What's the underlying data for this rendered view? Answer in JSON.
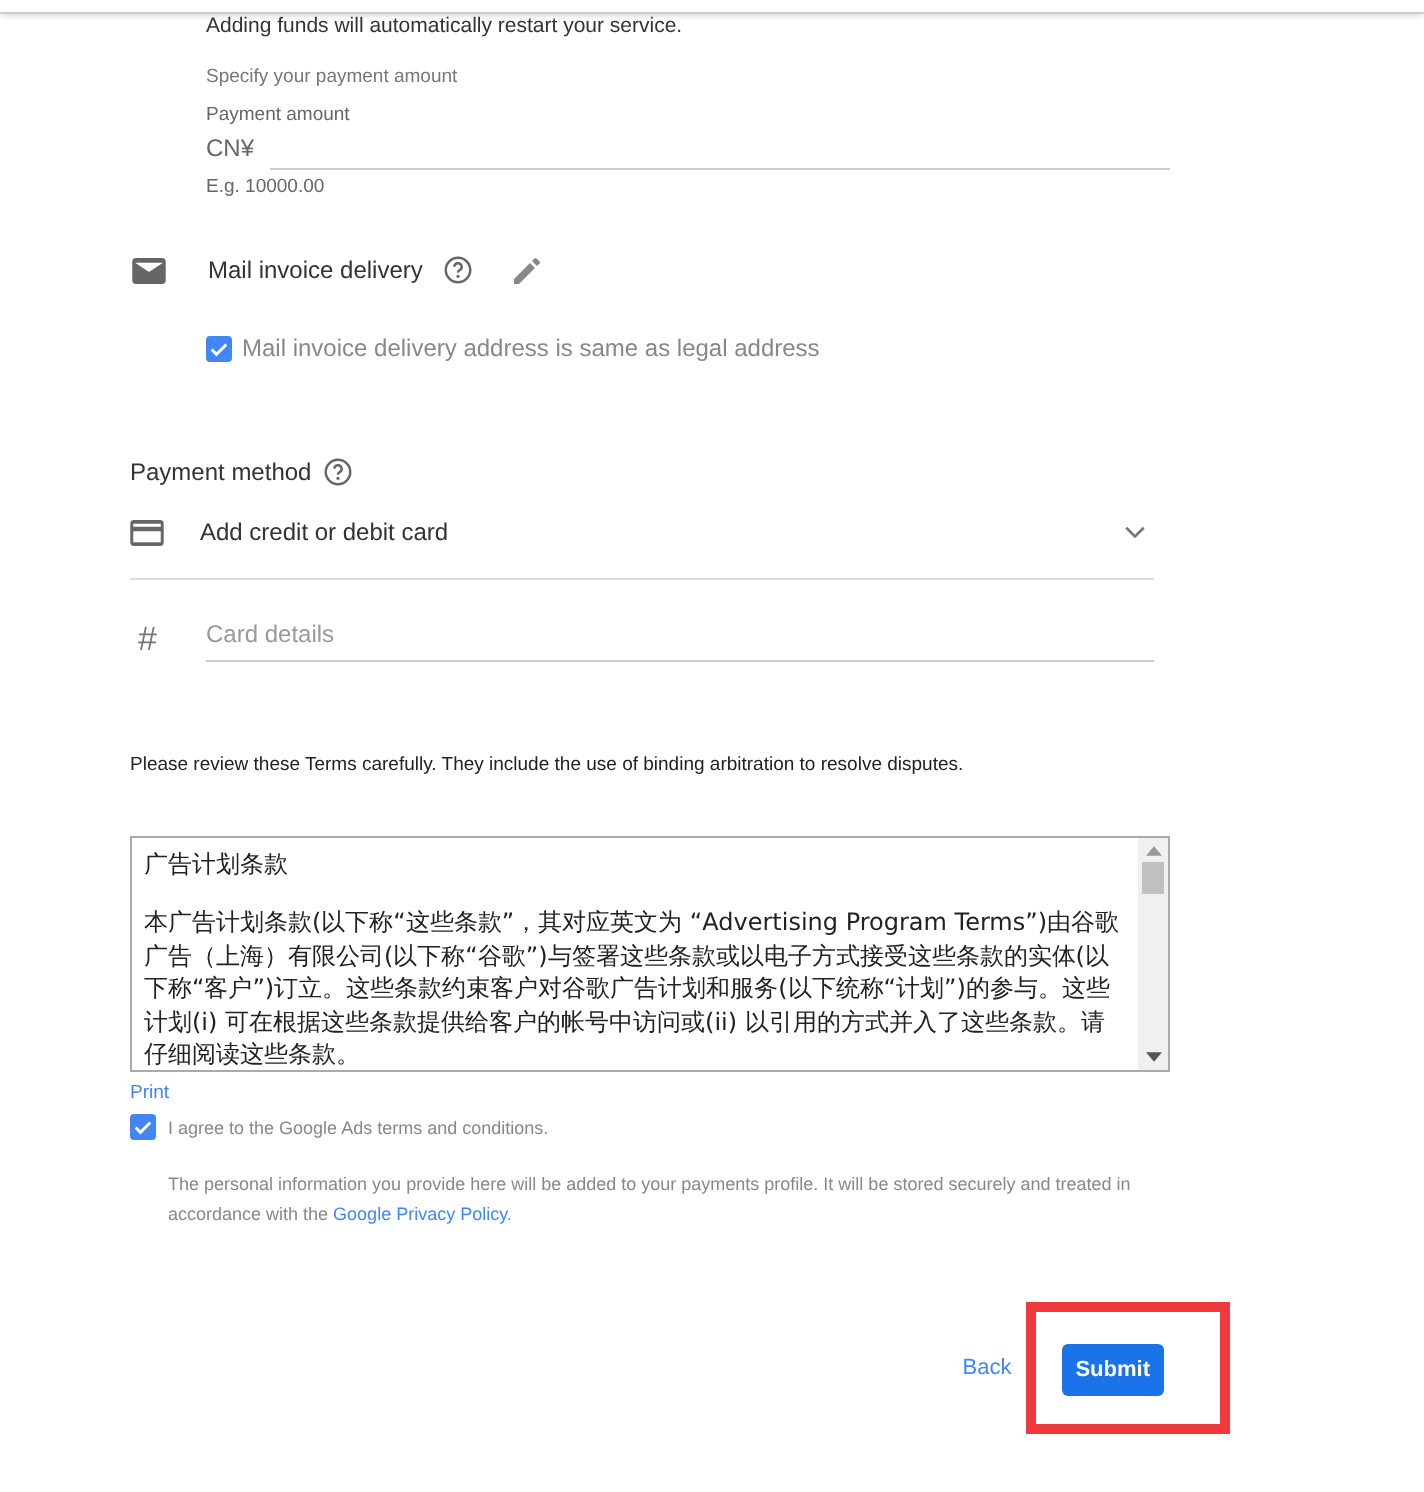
{
  "notice": "Adding funds will automatically restart your service.",
  "amount": {
    "hint": "Specify your payment amount",
    "label": "Payment amount",
    "currency": "CN¥",
    "helper": "E.g. 10000.00"
  },
  "mail_invoice": {
    "label": "Mail invoice delivery",
    "same_address": {
      "label": "Mail invoice delivery address is same as legal address",
      "checked": true
    }
  },
  "payment_method": {
    "title": "Payment method",
    "option": "Add credit or debit card",
    "card_field": {
      "icon": "#",
      "placeholder": "Card details"
    }
  },
  "terms_notice": "Please review these Terms carefully. They include the use of binding arbitration to resolve disputes.",
  "terms": {
    "title": "广告计划条款",
    "body": "本广告计划条款(以下称“这些条款”，其对应英文为 “Advertising Program Terms”)由谷歌广告（上海）有限公司(以下称“谷歌”)与签署这些条款或以电子方式接受这些条款的实体(以下称“客户”)订立。这些条款约束客户对谷歌广告计划和服务(以下统称“计划”)的参与。这些计划(i) 可在根据这些条款提供给客户的帐号中访问或(ii) 以引用的方式并入了这些条款。请仔细阅读这些条款。"
  },
  "print_link": "Print",
  "agree": {
    "label": "I agree to the Google Ads terms and conditions.",
    "checked": true
  },
  "privacy": {
    "text": "The personal information you provide here will be added to your payments profile. It will be stored securely and treated in accordance with the ",
    "link": "Google Privacy Policy",
    "end": "."
  },
  "buttons": {
    "back": "Back",
    "submit": "Submit",
    "submit_highlighted": true
  }
}
